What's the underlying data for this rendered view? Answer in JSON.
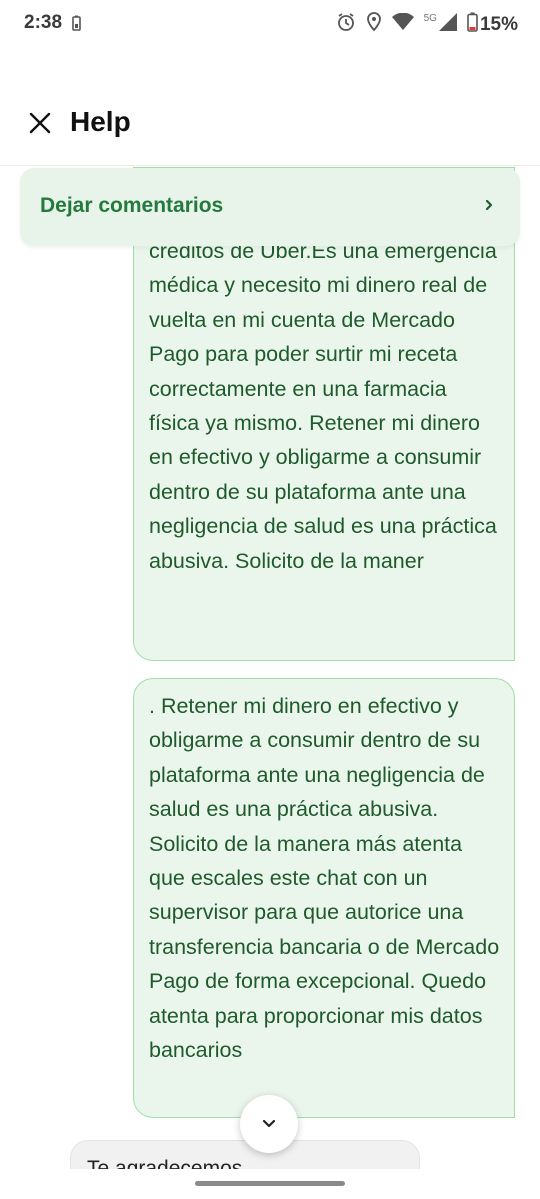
{
  "status_bar": {
    "time": "2:38",
    "network": "5G",
    "battery_percent": "15%"
  },
  "header": {
    "title": "Help"
  },
  "feedback": {
    "label": "Dejar comentarios",
    "chevron": "›"
  },
  "messages": [
    {
      "sender": "user",
      "text": "créditos de Uber.Es una emergencia médica y necesito mi dinero real de vuelta en mi cuenta de Mercado Pago para poder surtir mi receta correctamente en una farmacia física ya mismo. Retener mi dinero en efectivo y obligarme a consumir dentro de su plataforma ante una negligencia de salud es una práctica abusiva. Solicito de la maner"
    },
    {
      "sender": "user",
      "text": ". Retener mi dinero en efectivo y obligarme a consumir dentro de su plataforma ante una negligencia de salud es una práctica abusiva. Solicito de la manera más atenta que escales este chat con un supervisor para que autorice una transferencia bancaria o de Mercado Pago de forma excepcional. Quedo atenta para proporcionar mis datos bancarios"
    },
    {
      "sender": "agent",
      "text": "Te agradecemos"
    }
  ],
  "icons": {
    "close": "close-icon",
    "chevron_right": "chevron-right-icon",
    "scroll_down": "chevron-down-icon",
    "alarm": "alarm-icon",
    "location": "location-icon",
    "wifi": "wifi-icon",
    "signal": "signal-icon",
    "battery": "battery-icon"
  },
  "colors": {
    "accent_green": "#237a3b",
    "bubble_bg": "#eaf6ec",
    "bubble_border": "#9fdfa7",
    "bubble_text": "#1f5a2c",
    "battery_low": "#e53935"
  }
}
